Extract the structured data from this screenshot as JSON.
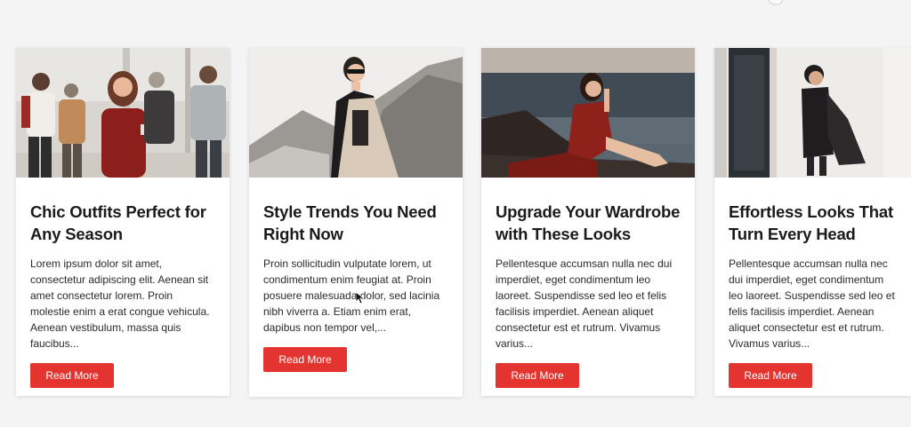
{
  "cards": [
    {
      "title": "Chic Outfits Perfect for Any Season",
      "description": "Lorem ipsum dolor sit amet, consectetur adipiscing elit. Aenean sit amet consectetur lorem. Proin molestie enim a erat congue vehicula. Aenean vestibulum, massa quis faucibus...",
      "button_label": "Read More",
      "image": "group-of-people-photo"
    },
    {
      "title": "Style Trends You Need Right Now",
      "description": "Proin sollicitudin vulputate lorem, ut condimentum enim feugiat at. Proin posuere malesuada dolor, sed lacinia nibh viverra a. Etiam enim erat, dapibus non tempor vel,...",
      "button_label": "Read More",
      "image": "woman-with-sunglasses-photo"
    },
    {
      "title": "Upgrade Your Wardrobe with These Looks",
      "description": "Pellentesque accumsan nulla nec dui imperdiet, eget condimentum leo laoreet. Suspendisse sed leo et felis facilisis imperdiet. Aenean aliquet consectetur est et rutrum. Vivamus varius...",
      "button_label": "Read More",
      "image": "woman-in-red-dress-by-sea-photo"
    },
    {
      "title": "Effortless Looks That Turn Every Head",
      "description": "Pellentesque accumsan nulla nec dui imperdiet, eget condimentum leo laoreet. Suspendisse sed leo et felis facilisis imperdiet. Aenean aliquet consectetur est et rutrum. Vivamus varius...",
      "button_label": "Read More",
      "image": "woman-in-dark-coat-photo"
    }
  ],
  "colors": {
    "accent": "#e3342f",
    "background": "#f4f4f4",
    "card": "#ffffff",
    "title_text": "#1b1b1b"
  }
}
